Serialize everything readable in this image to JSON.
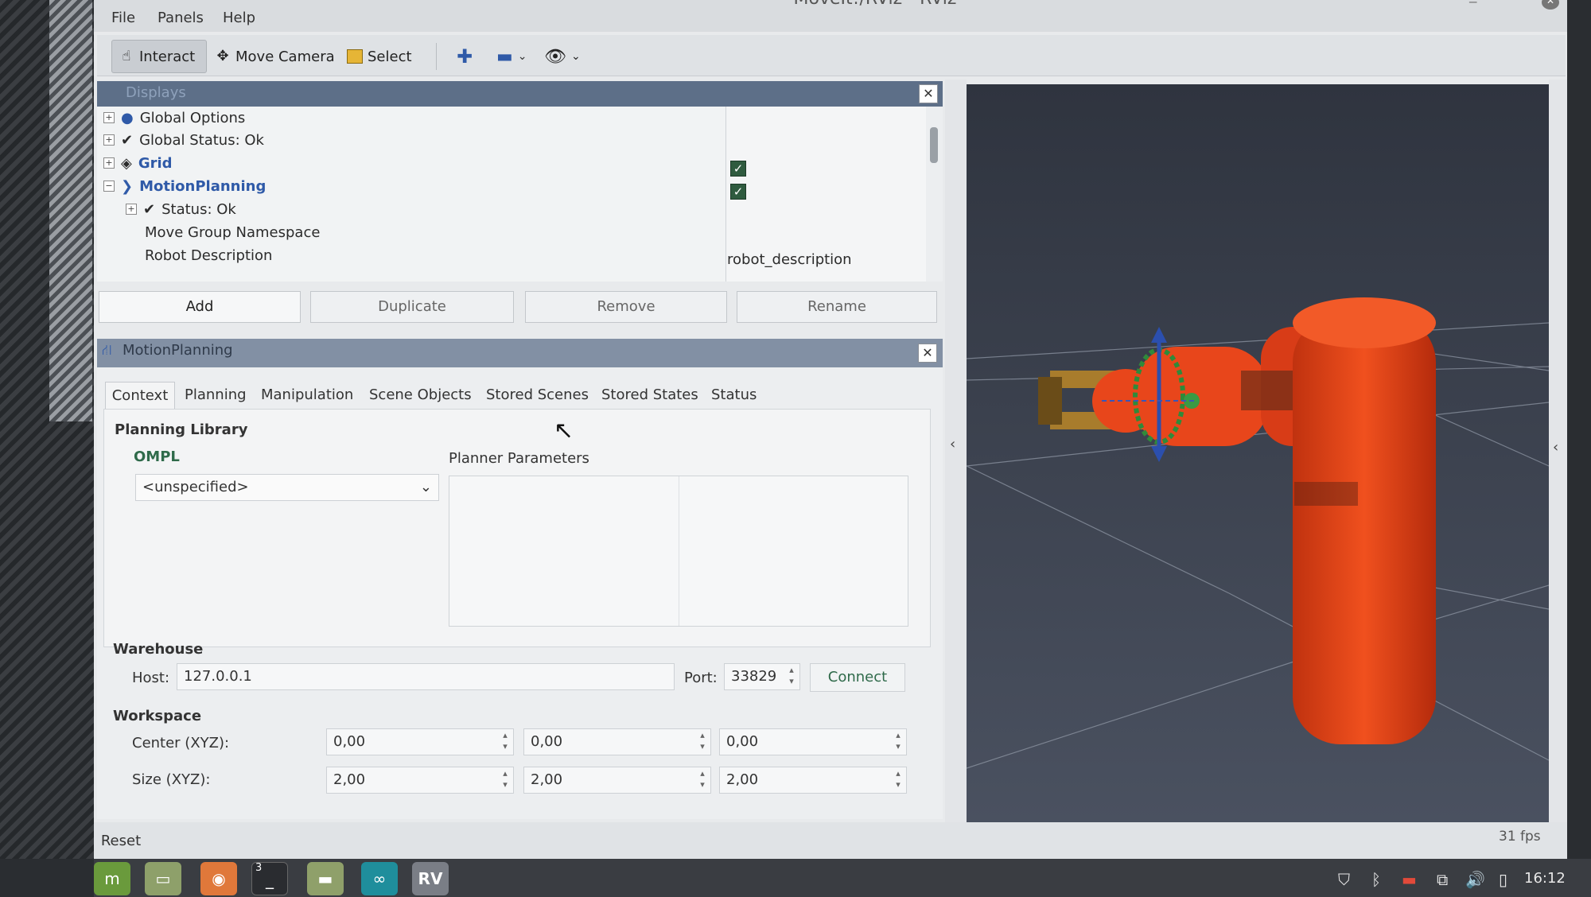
{
  "window": {
    "title": "MoveIt!/RViz - RViz"
  },
  "menu": [
    "File",
    "Panels",
    "Help"
  ],
  "toolbar": {
    "interact": "Interact",
    "move_camera": "Move Camera",
    "select": "Select"
  },
  "displays": {
    "title": "Displays",
    "tree": [
      {
        "label": "Global Options",
        "icon": "globe-icon"
      },
      {
        "label": "Global Status: Ok",
        "icon": "check-icon"
      },
      {
        "label": "Grid",
        "icon": "grid-icon",
        "checked": true
      },
      {
        "label": "MotionPlanning",
        "icon": "motion-planning-icon",
        "checked": true
      },
      {
        "label": "Status: Ok",
        "icon": "check-icon"
      },
      {
        "label": "Move Group Namespace"
      },
      {
        "label": "Robot Description",
        "value": "robot_description"
      }
    ],
    "buttons": {
      "add": "Add",
      "duplicate": "Duplicate",
      "remove": "Remove",
      "rename": "Rename"
    }
  },
  "motion_planning": {
    "title": "MotionPlanning",
    "tabs": [
      "Context",
      "Planning",
      "Manipulation",
      "Scene Objects",
      "Stored Scenes",
      "Stored States",
      "Status"
    ],
    "planning_library": "Planning Library",
    "library_name": "OMPL",
    "planner_select": "<unspecified>",
    "planner_parameters": "Planner Parameters",
    "warehouse": {
      "title": "Warehouse",
      "host_label": "Host:",
      "host": "127.0.0.1",
      "port_label": "Port:",
      "port": "33829",
      "connect": "Connect"
    },
    "workspace": {
      "title": "Workspace",
      "center_label": "Center (XYZ):",
      "center": [
        "0,00",
        "0,00",
        "0,00"
      ],
      "size_label": "Size (XYZ):",
      "size": [
        "2,00",
        "2,00",
        "2,00"
      ]
    }
  },
  "statusbar": {
    "reset": "Reset",
    "fps": "31 fps"
  },
  "taskbar": {
    "clock": "16:12",
    "terminal_badge": "3"
  },
  "colors": {
    "robot": "#e0401e",
    "view_bg": "#3e4552",
    "panel_header": "#5d6f88"
  }
}
